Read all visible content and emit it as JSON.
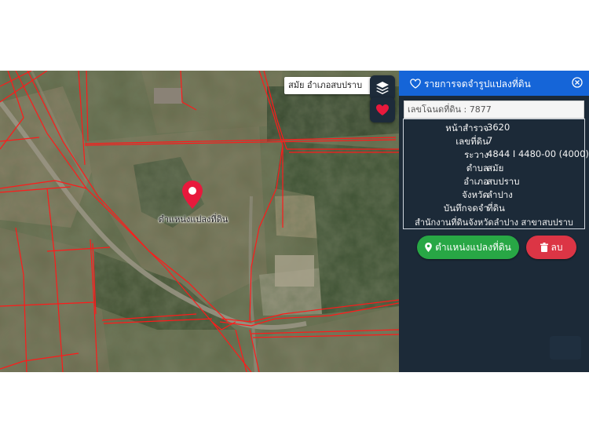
{
  "map": {
    "search_text": "สมัย อำเภอสบปราบ",
    "pin_label": "ตำแหน่งแปลงที่ดิน",
    "parcel_line_color": "#ff1a1a",
    "pin_color": "#e8193c"
  },
  "controls": {
    "layers_icon": "layers-icon",
    "favorite_icon": "heart-icon"
  },
  "panel": {
    "title": "รายการจดจำรูปแปลงที่ดิน",
    "deed_label": "เลขโฉนดที่ดิน : 7877",
    "rows": [
      {
        "label": "หน้าสำรวจ",
        "value": "3620"
      },
      {
        "label": "เลขที่ดิน",
        "value": "7"
      },
      {
        "label": "ระวาง",
        "value": "4844 I 4480-00 (4000)"
      },
      {
        "label": "ตำบล",
        "value": "สมัย"
      },
      {
        "label": "อำเภอ",
        "value": "สบปราบ"
      },
      {
        "label": "จังหวัด",
        "value": "ลำปาง"
      },
      {
        "label": "บันทึกจดจำ",
        "value": "ที่ดิน"
      }
    ],
    "office": "สำนักงานที่ดินจังหวัดลำปาง สาขาสบปราบ",
    "locate_button": "ตำแหน่งแปลงที่ดิน",
    "delete_button": "ลบ",
    "header_color": "#1565d8",
    "locate_color": "#28a745",
    "delete_color": "#dc3545"
  }
}
